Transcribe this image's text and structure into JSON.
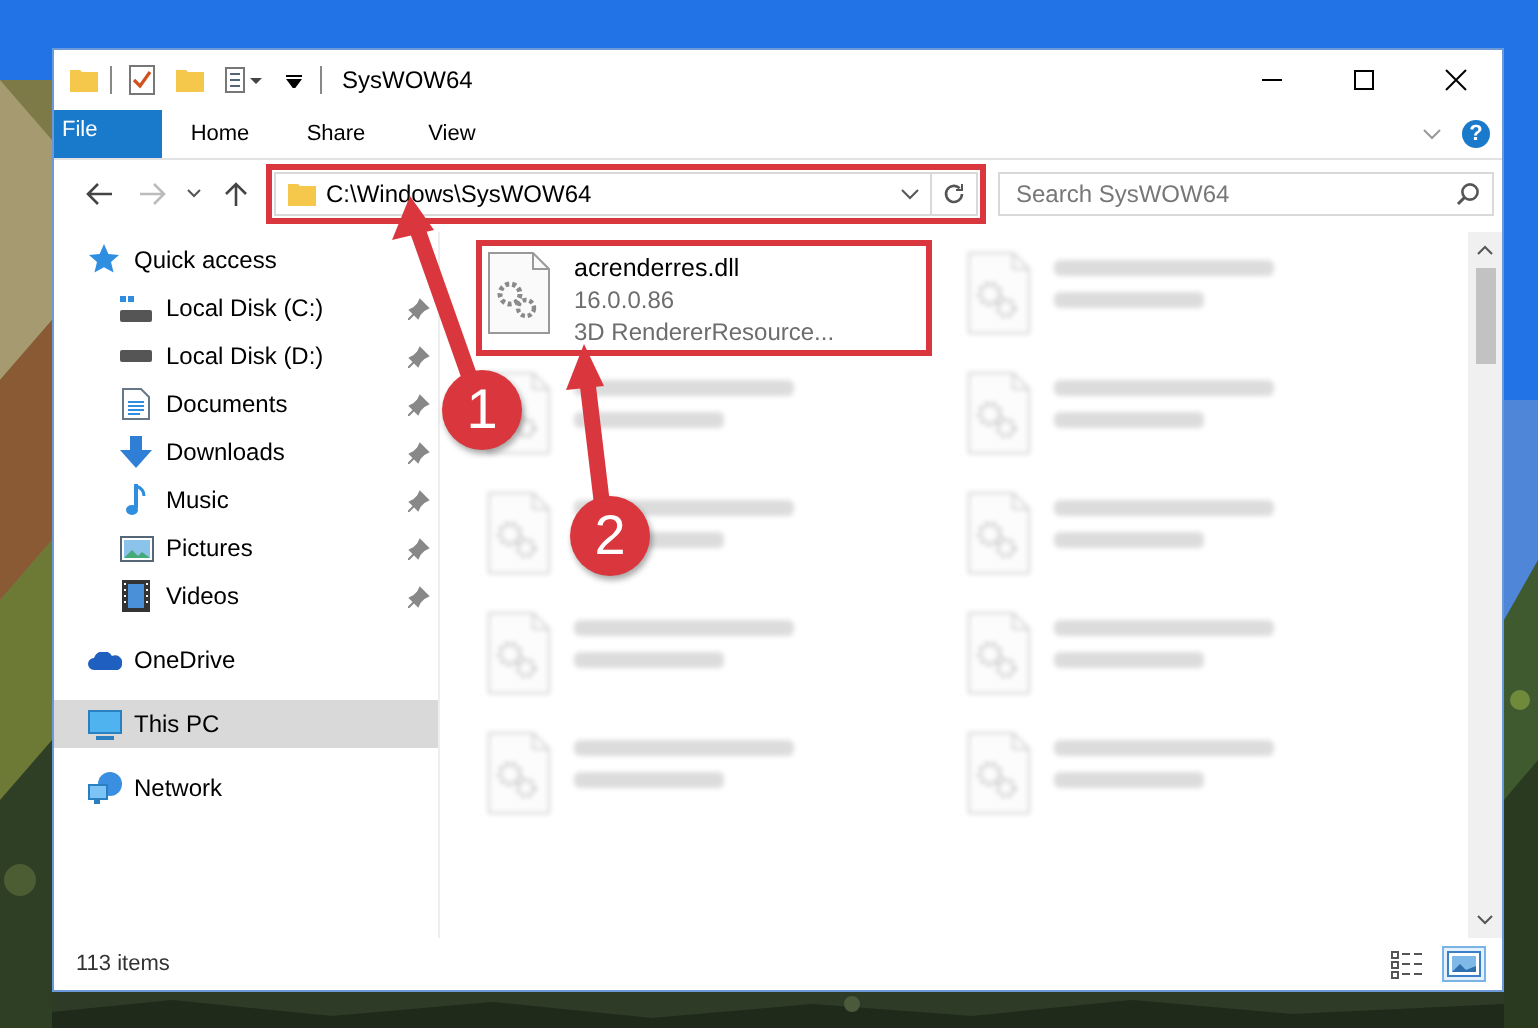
{
  "window": {
    "title": "SysWOW64"
  },
  "ribbon": {
    "tabs": [
      {
        "label": "File",
        "kind": "file"
      },
      {
        "label": "Home",
        "kind": "tab"
      },
      {
        "label": "Share",
        "kind": "tab"
      },
      {
        "label": "View",
        "kind": "tab"
      }
    ],
    "help": "?"
  },
  "address": {
    "path": "C:\\Windows\\SysWOW64",
    "highlighted": true
  },
  "search": {
    "placeholder": "Search SysWOW64"
  },
  "nav": [
    {
      "label": "Quick access",
      "kind": "star",
      "selected": false,
      "children": [
        {
          "label": "Local Disk (C:)",
          "kind": "drive-c",
          "pinned": true,
          "selected": false
        },
        {
          "label": "Local Disk (D:)",
          "kind": "drive",
          "pinned": true,
          "selected": false
        },
        {
          "label": "Documents",
          "kind": "documents",
          "pinned": true,
          "selected": false
        },
        {
          "label": "Downloads",
          "kind": "downloads",
          "pinned": true,
          "selected": false
        },
        {
          "label": "Music",
          "kind": "music",
          "pinned": true,
          "selected": false
        },
        {
          "label": "Pictures",
          "kind": "pictures",
          "pinned": true,
          "selected": false
        },
        {
          "label": "Videos",
          "kind": "videos",
          "pinned": true,
          "selected": false
        }
      ]
    },
    {
      "label": "OneDrive",
      "kind": "cloud",
      "selected": false
    },
    {
      "label": "This PC",
      "kind": "pc",
      "selected": true
    },
    {
      "label": "Network",
      "kind": "network",
      "selected": false
    }
  ],
  "files": [
    {
      "name": "acrenderres.dll",
      "details": [
        "16.0.0.86",
        "3D RendererResource..."
      ],
      "blurred": false,
      "highlighted": true
    },
    {
      "blurred": true
    },
    {
      "blurred": true
    },
    {
      "blurred": true
    },
    {
      "blurred": true
    },
    {
      "blurred": true
    },
    {
      "blurred": true
    },
    {
      "blurred": true
    },
    {
      "blurred": true
    },
    {
      "blurred": true
    }
  ],
  "status_bar": {
    "item_count": "113 items"
  },
  "view_buttons": [
    {
      "kind": "details",
      "selected": false
    },
    {
      "kind": "tiles",
      "selected": true
    }
  ],
  "annotations": [
    {
      "label": "1"
    },
    {
      "label": "2"
    }
  ]
}
